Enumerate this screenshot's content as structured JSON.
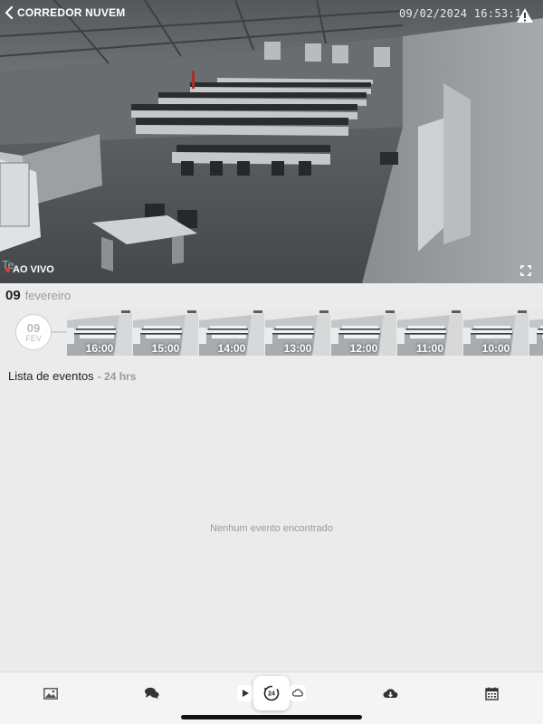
{
  "camera": {
    "title": "CORREDOR NUVEM",
    "timestamp": "09/02/2024 16:53:1",
    "live_label": "AO VIVO",
    "overlay_label": "Te"
  },
  "date": {
    "day": "09",
    "month": "fevereiro"
  },
  "timeline": {
    "day": "09",
    "month_abbr": "FEV",
    "thumbnails": [
      {
        "time": "16:00"
      },
      {
        "time": "15:00"
      },
      {
        "time": "14:00"
      },
      {
        "time": "13:00"
      },
      {
        "time": "12:00"
      },
      {
        "time": "11:00"
      },
      {
        "time": "10:00"
      },
      {
        "time": ""
      }
    ]
  },
  "events": {
    "title": "Lista de eventos",
    "range": "- 24 hrs",
    "empty_message": "Nenhum evento encontrado"
  },
  "bottom_bar": {
    "tabs": [
      {
        "icon": "image-icon"
      },
      {
        "icon": "chat-icon"
      },
      {
        "icon": "play-icon"
      },
      {
        "icon": "24h-replay-icon"
      },
      {
        "icon": "cloud-icon-small"
      },
      {
        "icon": "cloud-download-icon"
      },
      {
        "icon": "calendar-icon"
      }
    ]
  },
  "colors": {
    "live_dot": "#e53935",
    "background": "#ebebeb",
    "bar_background": "#f4f4f4"
  }
}
